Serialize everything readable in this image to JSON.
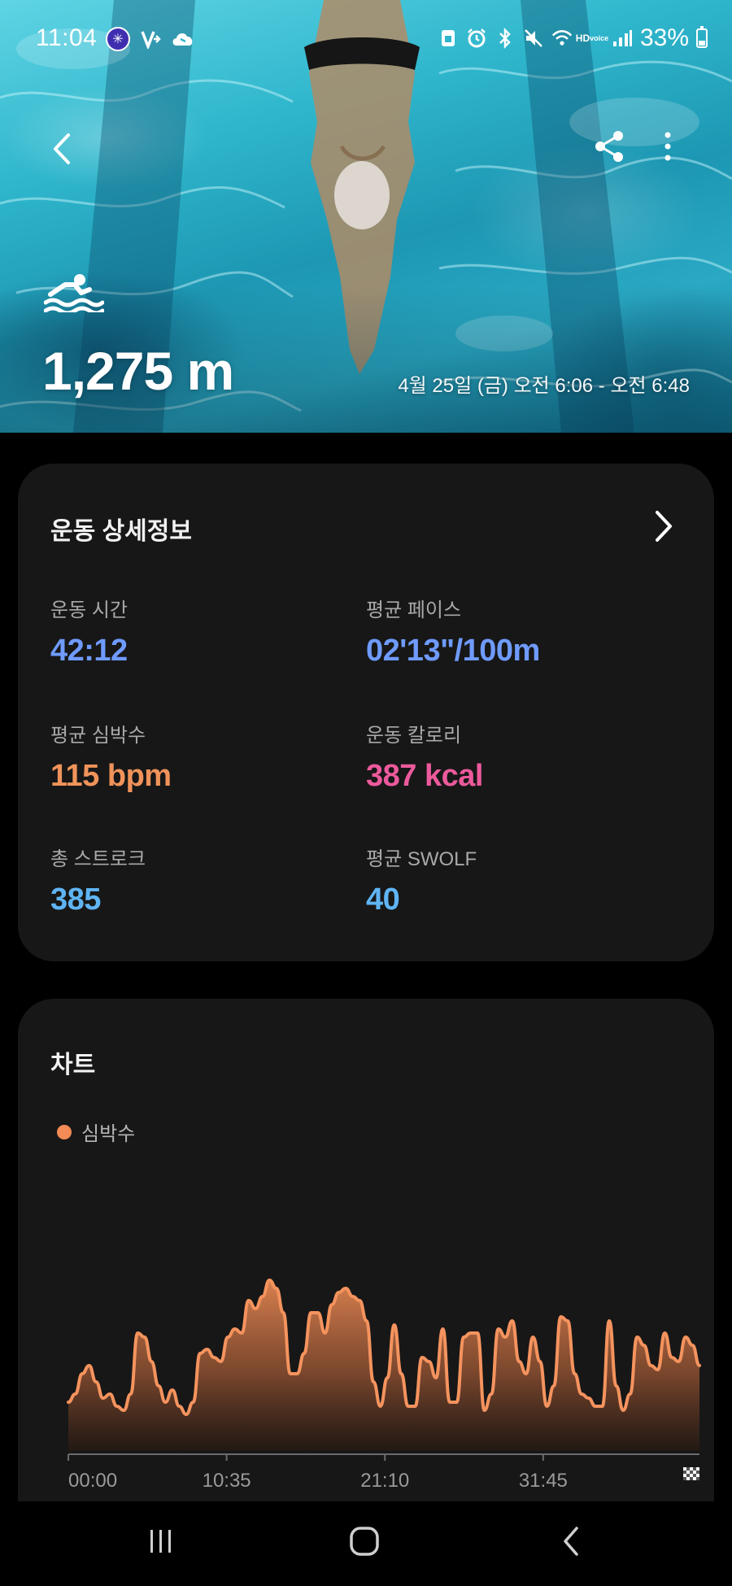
{
  "status_bar": {
    "time": "11:04",
    "battery": "33%",
    "hd_voice_top": "HD",
    "hd_voice_bottom": "voice",
    "left_icons": [
      "app-circle-icon",
      "app-v-icon",
      "cloud-icon"
    ],
    "right_icons": [
      "save-icon",
      "alarm-icon",
      "bluetooth-icon",
      "mute-icon",
      "wifi-icon",
      "hd-voice-icon",
      "signal-icon"
    ]
  },
  "hero": {
    "activity_icon": "swimming-icon",
    "distance": "1,275 m",
    "datetime": "4월 25일 (금) 오전 6:06 - 오전 6:48"
  },
  "details": {
    "title": "운동 상세정보",
    "stats": [
      {
        "label": "운동 시간",
        "value": "42:12",
        "color": "#6f9bff"
      },
      {
        "label": "평균 페이스",
        "value": "02'13\"/100m",
        "color": "#6f9bff"
      },
      {
        "label": "평균 심박수",
        "value": "115 bpm",
        "color": "#f0935a"
      },
      {
        "label": "운동 칼로리",
        "value": "387 kcal",
        "color": "#ec5a9c"
      },
      {
        "label": "총 스트로크",
        "value": "385",
        "color": "#5fb4f3"
      },
      {
        "label": "평균 SWOLF",
        "value": "40",
        "color": "#5fb4f3"
      }
    ]
  },
  "chart": {
    "title": "차트",
    "legend_label": "심박수"
  },
  "chart_data": {
    "type": "area",
    "title": "",
    "series": [
      {
        "name": "심박수",
        "color": "#f28b55"
      }
    ],
    "x_tick_labels": [
      "00:00",
      "10:35",
      "21:10",
      "31:45"
    ],
    "x_end_marker": "finish-flag-icon",
    "x_range_minutes": [
      0,
      42.2
    ],
    "y": [
      104,
      106,
      111,
      113,
      109,
      105,
      106,
      103,
      102,
      106,
      121,
      120,
      114,
      108,
      104,
      107,
      103,
      101,
      104,
      116,
      117,
      115,
      114,
      120,
      122,
      121,
      129,
      127,
      130,
      134,
      132,
      126,
      111,
      111,
      116,
      126,
      126,
      121,
      128,
      131,
      132,
      130,
      129,
      124,
      109,
      103,
      110,
      123,
      111,
      103,
      103,
      115,
      114,
      110,
      122,
      104,
      104,
      120,
      121,
      121,
      102,
      106,
      122,
      120,
      124,
      114,
      111,
      120,
      114,
      103,
      108,
      125,
      124,
      111,
      106,
      105,
      103,
      103,
      124,
      108,
      102,
      106,
      120,
      118,
      113,
      112,
      121,
      115,
      114,
      120,
      118,
      113
    ],
    "y_scale": "unlabeled",
    "grid": false
  },
  "nav_bar": {
    "buttons": [
      "recent-apps",
      "home",
      "back"
    ]
  }
}
